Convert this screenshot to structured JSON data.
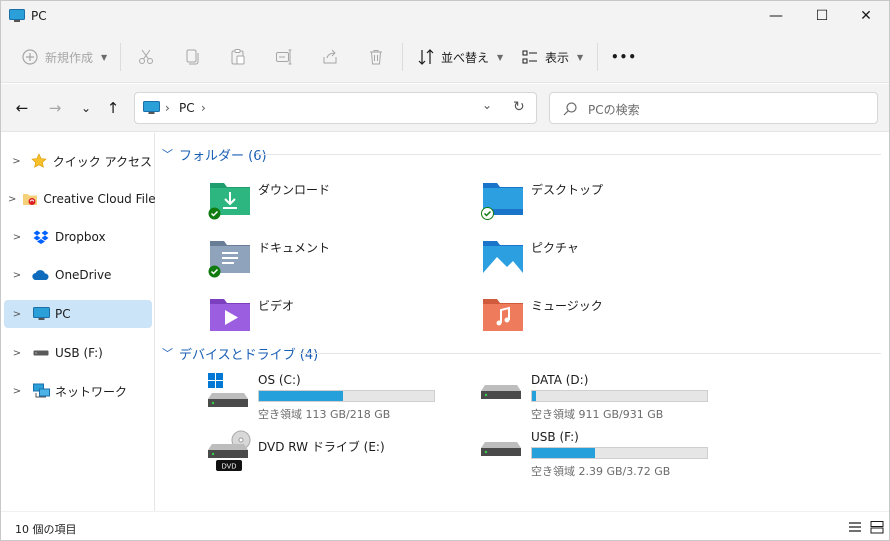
{
  "window": {
    "title": "PC"
  },
  "window_controls": {
    "minimize": "—",
    "maximize": "☐",
    "close": "✕"
  },
  "toolbar": {
    "new_label": "新規作成",
    "sort_label": "並べ替え",
    "view_label": "表示",
    "more_label": "•••"
  },
  "address": {
    "crumb": "PC",
    "sep1": "›",
    "sep2": "›",
    "dropdown": "⌄",
    "refresh": "↻"
  },
  "search": {
    "placeholder": "PCの検索"
  },
  "nav": {
    "back": "←",
    "forward": "→",
    "recent": "⌄",
    "up": "↑"
  },
  "sidebar": {
    "items": [
      {
        "label": "クイック アクセス",
        "icon": "star-icon"
      },
      {
        "label": "Creative Cloud Files",
        "icon": "creative-cloud-icon"
      },
      {
        "label": "Dropbox",
        "icon": "dropbox-icon"
      },
      {
        "label": "OneDrive",
        "icon": "onedrive-icon"
      },
      {
        "label": "PC",
        "icon": "pc-icon",
        "selected": true
      },
      {
        "label": "USB (F:)",
        "icon": "usb-drive-icon"
      },
      {
        "label": "ネットワーク",
        "icon": "network-icon"
      }
    ]
  },
  "folders": {
    "header": "フォルダー (6)",
    "items": [
      {
        "label": "ダウンロード",
        "icon": "downloads-folder-icon",
        "synced": true
      },
      {
        "label": "デスクトップ",
        "icon": "desktop-folder-icon",
        "synced": true
      },
      {
        "label": "ドキュメント",
        "icon": "documents-folder-icon",
        "synced": true
      },
      {
        "label": "ピクチャ",
        "icon": "pictures-folder-icon",
        "synced": false
      },
      {
        "label": "ビデオ",
        "icon": "videos-folder-icon",
        "synced": false
      },
      {
        "label": "ミュージック",
        "icon": "music-folder-icon",
        "synced": false
      }
    ]
  },
  "drives": {
    "header": "デバイスとドライブ (4)",
    "items": [
      {
        "label": "OS (C:)",
        "free": "空き領域 113 GB/218 GB",
        "used_fraction": 0.48,
        "icon": "windows-drive-icon"
      },
      {
        "label": "DATA (D:)",
        "free": "空き領域 911 GB/931 GB",
        "used_fraction": 0.02,
        "icon": "hard-drive-icon"
      },
      {
        "label": "DVD RW ドライブ (E:)",
        "badge": "DVD",
        "icon": "dvd-drive-icon"
      },
      {
        "label": "USB (F:)",
        "free": "空き領域 2.39 GB/3.72 GB",
        "used_fraction": 0.36,
        "icon": "usb-drive-icon"
      }
    ]
  },
  "status": {
    "count": "10 個の項目"
  },
  "colors": {
    "accent": "#1a5fb4",
    "selection": "#cce4f7",
    "bar": "#26a0da",
    "sync_green": "#107c10"
  }
}
